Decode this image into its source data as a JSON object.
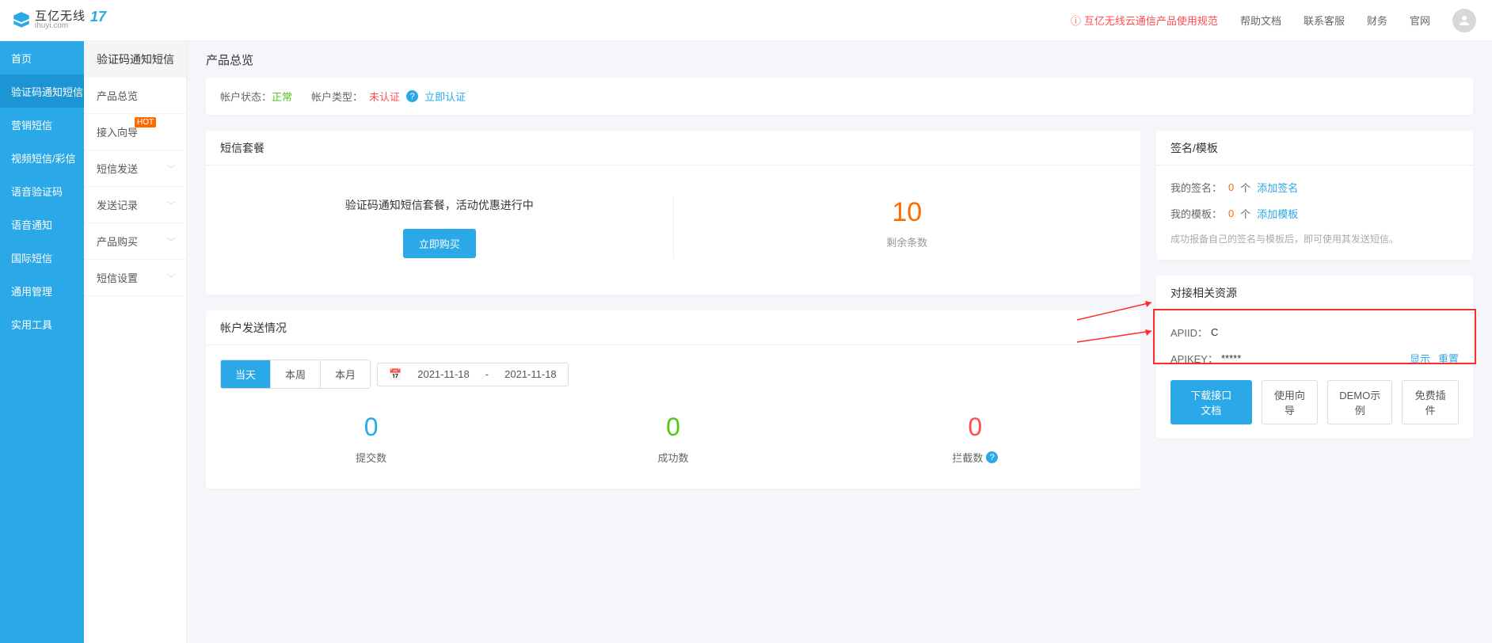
{
  "logo": {
    "cn": "互亿无线",
    "en": "ihuyi.com",
    "badge": "17"
  },
  "header": {
    "notice": "互亿无线云通信产品使用规范",
    "links": {
      "help": "帮助文档",
      "contact": "联系客服",
      "finance": "财务",
      "site": "官网"
    }
  },
  "sidebar1": {
    "items": [
      {
        "key": "home",
        "label": "首页"
      },
      {
        "key": "sms-verify",
        "label": "验证码通知短信"
      },
      {
        "key": "sms-market",
        "label": "营销短信"
      },
      {
        "key": "video-mms",
        "label": "视频短信/彩信"
      },
      {
        "key": "voice-verify",
        "label": "语音验证码"
      },
      {
        "key": "voice-notice",
        "label": "语音通知"
      },
      {
        "key": "intl",
        "label": "国际短信"
      },
      {
        "key": "general",
        "label": "通用管理"
      },
      {
        "key": "tools",
        "label": "实用工具"
      }
    ],
    "activeIndex": 1
  },
  "sidebar2": {
    "title": "验证码通知短信",
    "items": [
      {
        "label": "产品总览",
        "expandable": false
      },
      {
        "label": "接入向导",
        "expandable": false,
        "hot": true
      },
      {
        "label": "短信发送",
        "expandable": true
      },
      {
        "label": "发送记录",
        "expandable": true
      },
      {
        "label": "产品购买",
        "expandable": true
      },
      {
        "label": "短信设置",
        "expandable": true
      }
    ]
  },
  "main": {
    "pageTitle": "产品总览",
    "status": {
      "statusLabel": "帐户状态：",
      "statusValue": "正常",
      "typeLabel": "帐户类型：",
      "typeValue": "未认证",
      "certLink": "立即认证"
    },
    "package": {
      "title": "短信套餐",
      "desc": "验证码通知短信套餐，活动优惠进行中",
      "buyBtn": "立即购买",
      "remainNum": "10",
      "remainLabel": "剩余条数"
    },
    "stats": {
      "title": "帐户发送情况",
      "tabs": {
        "today": "当天",
        "week": "本周",
        "month": "本月"
      },
      "dateFrom": "2021-11-18",
      "dateSep": "-",
      "dateTo": "2021-11-18",
      "items": [
        {
          "num": "0",
          "label": "提交数",
          "cls": "blue"
        },
        {
          "num": "0",
          "label": "成功数",
          "cls": "green"
        },
        {
          "num": "0",
          "label": "拦截数",
          "cls": "red",
          "help": true
        }
      ]
    },
    "signTpl": {
      "title": "签名/模板",
      "signLabel": "我的签名：",
      "signCount": "0",
      "unit": "个",
      "signLink": "添加签名",
      "tplLabel": "我的模板：",
      "tplCount": "0",
      "tplLink": "添加模板",
      "tip": "成功报备自己的签名与模板后，即可使用其发送短信。"
    },
    "api": {
      "title": "对接相关资源",
      "idLabel": "APIID：",
      "idValue": "C",
      "keyLabel": "APIKEY：",
      "keyValue": "*****",
      "show": "显示",
      "reset": "重置",
      "btns": {
        "download": "下载接口文档",
        "guide": "使用向导",
        "demo": "DEMO示例",
        "plugin": "免费插件"
      }
    }
  }
}
